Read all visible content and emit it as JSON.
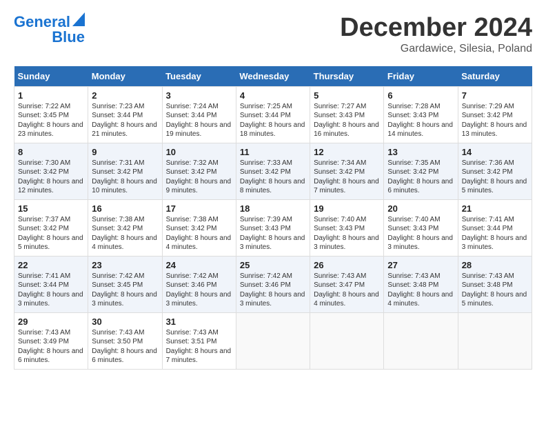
{
  "logo": {
    "line1": "General",
    "line2": "Blue"
  },
  "title": "December 2024",
  "subtitle": "Gardawice, Silesia, Poland",
  "days_of_week": [
    "Sunday",
    "Monday",
    "Tuesday",
    "Wednesday",
    "Thursday",
    "Friday",
    "Saturday"
  ],
  "weeks": [
    [
      {
        "day": "1",
        "sunrise": "7:22 AM",
        "sunset": "3:45 PM",
        "daylight": "8 hours and 23 minutes."
      },
      {
        "day": "2",
        "sunrise": "7:23 AM",
        "sunset": "3:44 PM",
        "daylight": "8 hours and 21 minutes."
      },
      {
        "day": "3",
        "sunrise": "7:24 AM",
        "sunset": "3:44 PM",
        "daylight": "8 hours and 19 minutes."
      },
      {
        "day": "4",
        "sunrise": "7:25 AM",
        "sunset": "3:44 PM",
        "daylight": "8 hours and 18 minutes."
      },
      {
        "day": "5",
        "sunrise": "7:27 AM",
        "sunset": "3:43 PM",
        "daylight": "8 hours and 16 minutes."
      },
      {
        "day": "6",
        "sunrise": "7:28 AM",
        "sunset": "3:43 PM",
        "daylight": "8 hours and 14 minutes."
      },
      {
        "day": "7",
        "sunrise": "7:29 AM",
        "sunset": "3:42 PM",
        "daylight": "8 hours and 13 minutes."
      }
    ],
    [
      {
        "day": "8",
        "sunrise": "7:30 AM",
        "sunset": "3:42 PM",
        "daylight": "8 hours and 12 minutes."
      },
      {
        "day": "9",
        "sunrise": "7:31 AM",
        "sunset": "3:42 PM",
        "daylight": "8 hours and 10 minutes."
      },
      {
        "day": "10",
        "sunrise": "7:32 AM",
        "sunset": "3:42 PM",
        "daylight": "8 hours and 9 minutes."
      },
      {
        "day": "11",
        "sunrise": "7:33 AM",
        "sunset": "3:42 PM",
        "daylight": "8 hours and 8 minutes."
      },
      {
        "day": "12",
        "sunrise": "7:34 AM",
        "sunset": "3:42 PM",
        "daylight": "8 hours and 7 minutes."
      },
      {
        "day": "13",
        "sunrise": "7:35 AM",
        "sunset": "3:42 PM",
        "daylight": "8 hours and 6 minutes."
      },
      {
        "day": "14",
        "sunrise": "7:36 AM",
        "sunset": "3:42 PM",
        "daylight": "8 hours and 5 minutes."
      }
    ],
    [
      {
        "day": "15",
        "sunrise": "7:37 AM",
        "sunset": "3:42 PM",
        "daylight": "8 hours and 5 minutes."
      },
      {
        "day": "16",
        "sunrise": "7:38 AM",
        "sunset": "3:42 PM",
        "daylight": "8 hours and 4 minutes."
      },
      {
        "day": "17",
        "sunrise": "7:38 AM",
        "sunset": "3:42 PM",
        "daylight": "8 hours and 4 minutes."
      },
      {
        "day": "18",
        "sunrise": "7:39 AM",
        "sunset": "3:43 PM",
        "daylight": "8 hours and 3 minutes."
      },
      {
        "day": "19",
        "sunrise": "7:40 AM",
        "sunset": "3:43 PM",
        "daylight": "8 hours and 3 minutes."
      },
      {
        "day": "20",
        "sunrise": "7:40 AM",
        "sunset": "3:43 PM",
        "daylight": "8 hours and 3 minutes."
      },
      {
        "day": "21",
        "sunrise": "7:41 AM",
        "sunset": "3:44 PM",
        "daylight": "8 hours and 3 minutes."
      }
    ],
    [
      {
        "day": "22",
        "sunrise": "7:41 AM",
        "sunset": "3:44 PM",
        "daylight": "8 hours and 3 minutes."
      },
      {
        "day": "23",
        "sunrise": "7:42 AM",
        "sunset": "3:45 PM",
        "daylight": "8 hours and 3 minutes."
      },
      {
        "day": "24",
        "sunrise": "7:42 AM",
        "sunset": "3:46 PM",
        "daylight": "8 hours and 3 minutes."
      },
      {
        "day": "25",
        "sunrise": "7:42 AM",
        "sunset": "3:46 PM",
        "daylight": "8 hours and 3 minutes."
      },
      {
        "day": "26",
        "sunrise": "7:43 AM",
        "sunset": "3:47 PM",
        "daylight": "8 hours and 4 minutes."
      },
      {
        "day": "27",
        "sunrise": "7:43 AM",
        "sunset": "3:48 PM",
        "daylight": "8 hours and 4 minutes."
      },
      {
        "day": "28",
        "sunrise": "7:43 AM",
        "sunset": "3:48 PM",
        "daylight": "8 hours and 5 minutes."
      }
    ],
    [
      {
        "day": "29",
        "sunrise": "7:43 AM",
        "sunset": "3:49 PM",
        "daylight": "8 hours and 6 minutes."
      },
      {
        "day": "30",
        "sunrise": "7:43 AM",
        "sunset": "3:50 PM",
        "daylight": "8 hours and 6 minutes."
      },
      {
        "day": "31",
        "sunrise": "7:43 AM",
        "sunset": "3:51 PM",
        "daylight": "8 hours and 7 minutes."
      },
      null,
      null,
      null,
      null
    ]
  ]
}
